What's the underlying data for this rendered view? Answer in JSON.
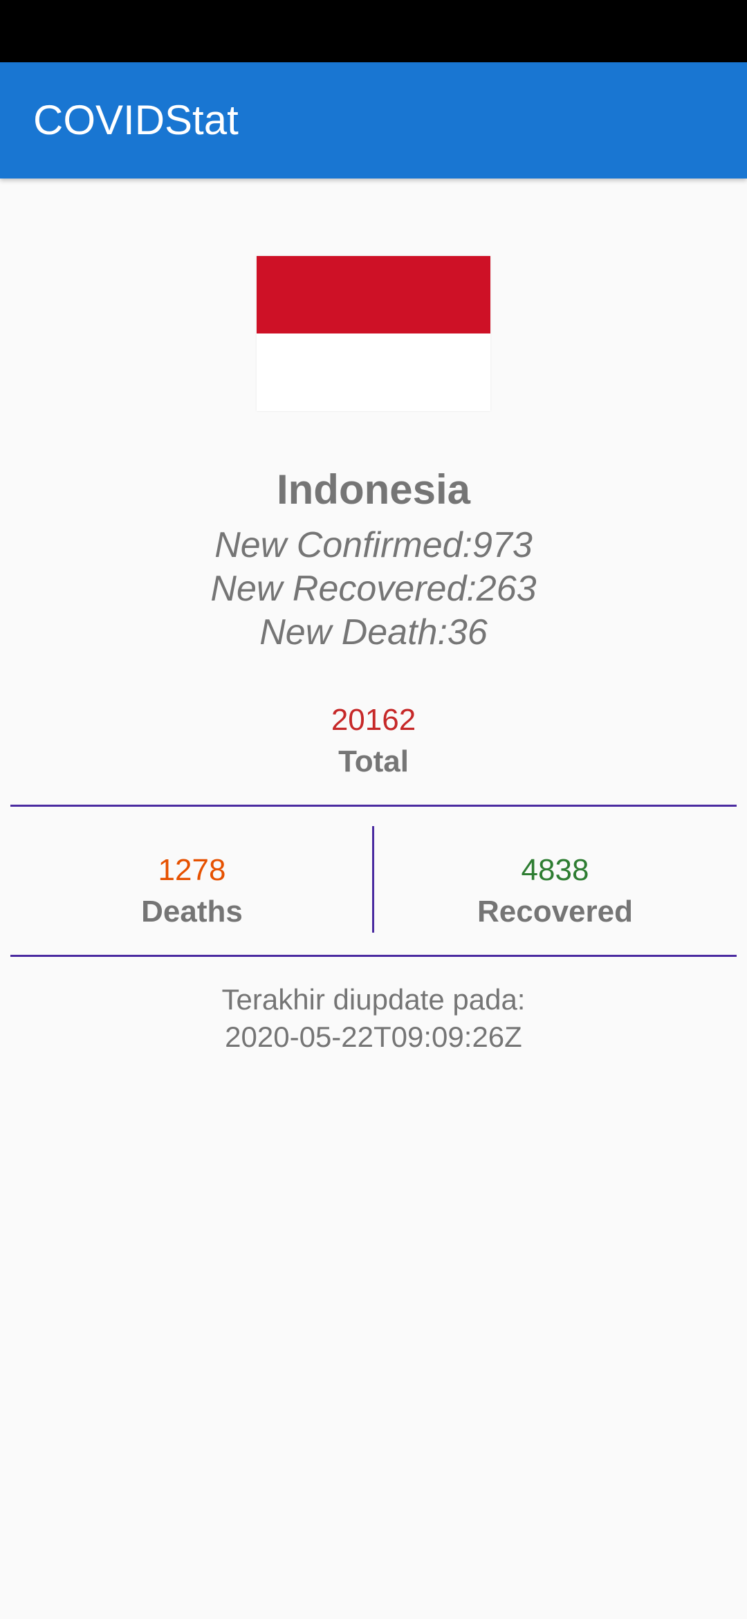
{
  "app": {
    "title": "COVIDStat"
  },
  "country": {
    "name": "Indonesia",
    "flag_colors": [
      "#ce1126",
      "#ffffff"
    ],
    "new_confirmed": "New Confirmed:973",
    "new_recovered": "New Recovered:263",
    "new_death": "New Death:36"
  },
  "totals": {
    "total_value": "20162",
    "total_label": "Total",
    "deaths_value": "1278",
    "deaths_label": "Deaths",
    "recovered_value": "4838",
    "recovered_label": "Recovered"
  },
  "updated": {
    "label": "Terakhir diupdate pada:",
    "value": "2020-05-22T09:09:26Z"
  },
  "colors": {
    "app_bar": "#1976d2",
    "status_bar": "#000000",
    "total": "#c62828",
    "deaths": "#e65100",
    "recovered": "#2e7d32",
    "divider": "#4a2aa0"
  }
}
